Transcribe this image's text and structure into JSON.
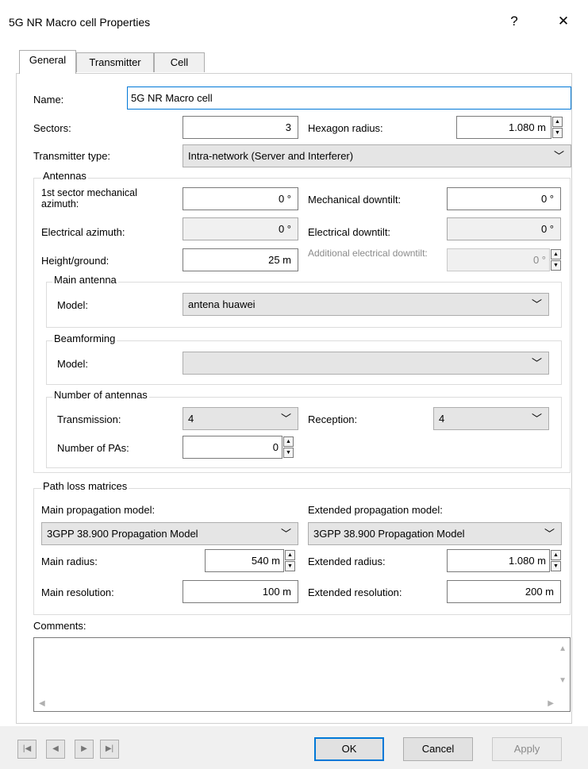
{
  "window": {
    "title": "5G NR Macro cell Properties",
    "help": "?",
    "close": "✕"
  },
  "tabs": [
    "General",
    "Transmitter",
    "Cell"
  ],
  "general": {
    "name_label": "Name:",
    "name_value": "5G NR Macro cell",
    "sectors_label": "Sectors:",
    "sectors_value": "3",
    "hex_label": "Hexagon radius:",
    "hex_value": "1.080  m",
    "tx_type_label": "Transmitter type:",
    "tx_type_value": "Intra-network (Server and Interferer)"
  },
  "antennas": {
    "title": "Antennas",
    "mech_az_label": "1st sector mechanical azimuth:",
    "mech_az_value": "0 °",
    "mech_tilt_label": "Mechanical downtilt:",
    "mech_tilt_value": "0 °",
    "elec_az_label": "Electrical azimuth:",
    "elec_az_value": "0 °",
    "elec_tilt_label": "Electrical downtilt:",
    "elec_tilt_value": "0 °",
    "height_label": "Height/ground:",
    "height_value": "25  m",
    "add_tilt_label": "Additional electrical downtilt:",
    "add_tilt_value": "0 °"
  },
  "main_antenna": {
    "title": "Main antenna",
    "model_label": "Model:",
    "model_value": "antena huawei"
  },
  "beamforming": {
    "title": "Beamforming",
    "model_label": "Model:",
    "model_value": ""
  },
  "num_antennas": {
    "title": "Number of antennas",
    "tx_label": "Transmission:",
    "tx_value": "4",
    "rx_label": "Reception:",
    "rx_value": "4",
    "pas_label": "Number of PAs:",
    "pas_value": "0"
  },
  "path_loss": {
    "title": "Path loss matrices",
    "main_model_label": "Main propagation model:",
    "main_model_value": "3GPP 38.900 Propagation Model",
    "ext_model_label": "Extended propagation model:",
    "ext_model_value": "3GPP 38.900 Propagation Model",
    "main_radius_label": "Main radius:",
    "main_radius_value": "540  m",
    "ext_radius_label": "Extended radius:",
    "ext_radius_value": "1.080  m",
    "main_res_label": "Main resolution:",
    "main_res_value": "100  m",
    "ext_res_label": "Extended resolution:",
    "ext_res_value": "200  m"
  },
  "comments": {
    "label": "Comments:",
    "value": ""
  },
  "buttons": {
    "ok": "OK",
    "cancel": "Cancel",
    "apply": "Apply"
  },
  "nav": {
    "first": "|◀",
    "prev": "◀",
    "next": "▶",
    "last": "▶|"
  }
}
